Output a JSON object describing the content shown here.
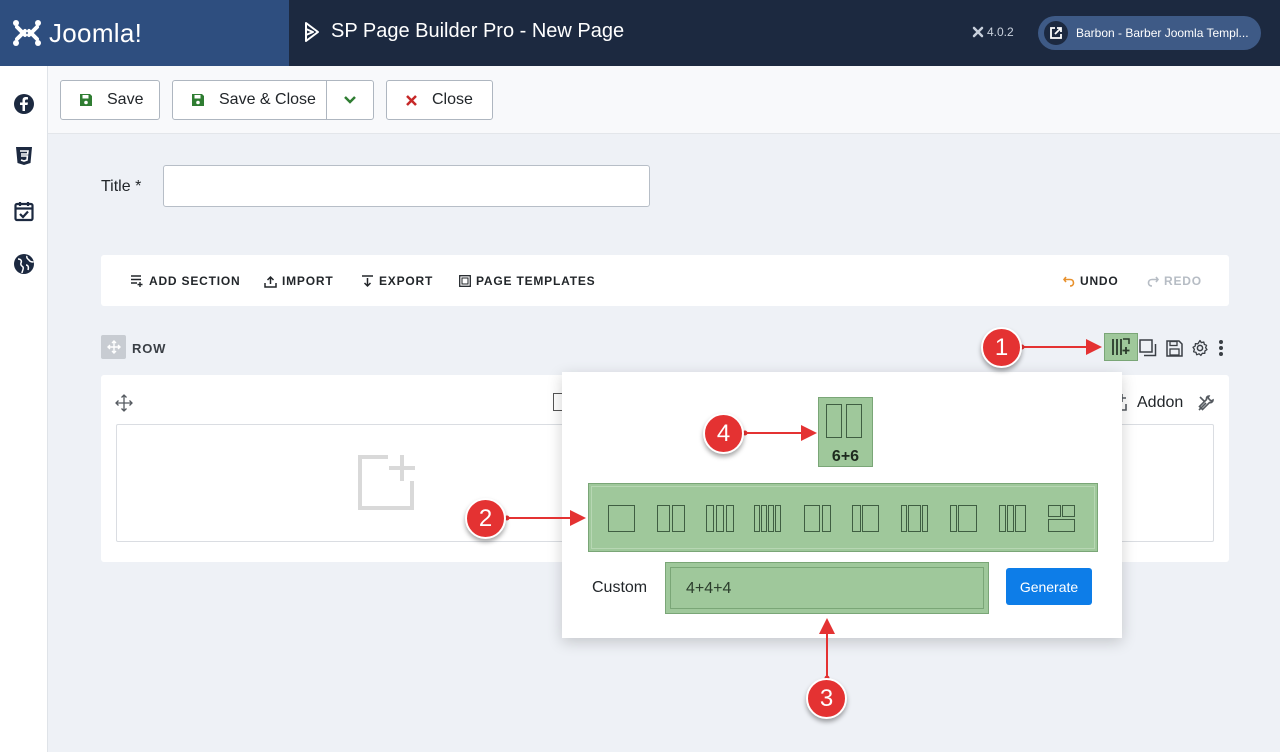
{
  "header": {
    "brand": "Joomla!",
    "page_title": "SP Page Builder Pro - New Page",
    "version": "4.0.2",
    "site_link": "Barbon - Barber Joomla Templ..."
  },
  "sidebar": {
    "items": [
      {
        "icon": "facebook-icon"
      },
      {
        "icon": "css3-icon"
      },
      {
        "icon": "calendar-check-icon"
      },
      {
        "icon": "globe-icon"
      }
    ]
  },
  "toolbar": {
    "save_label": "Save",
    "save_close_label": "Save & Close",
    "close_label": "Close"
  },
  "form": {
    "title_label": "Title *",
    "title_value": ""
  },
  "builder": {
    "add_section": "ADD SECTION",
    "import": "IMPORT",
    "export": "EXPORT",
    "page_templates": "PAGE TEMPLATES",
    "undo": "UNDO",
    "redo": "REDO"
  },
  "row": {
    "label": "ROW",
    "addon_label": "Addon"
  },
  "popup": {
    "preview_label": "6+6",
    "custom_label": "Custom",
    "custom_value": "4+4+4",
    "generate_label": "Generate"
  },
  "callouts": [
    "1",
    "2",
    "3",
    "4"
  ],
  "colors": {
    "header_bg": "#1c2940",
    "logo_bg": "#2e4e7f",
    "highlight": "#9fc89b",
    "callout": "#e43232",
    "primary": "#0d7de8"
  }
}
